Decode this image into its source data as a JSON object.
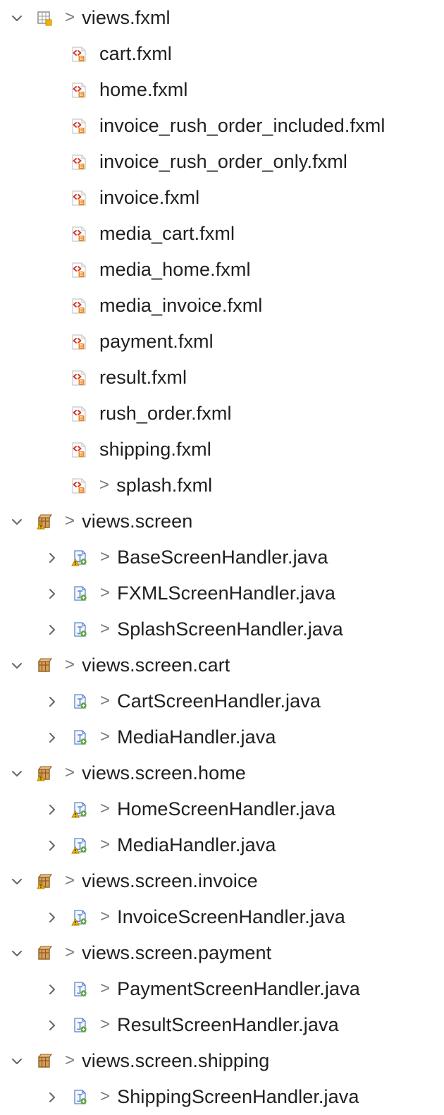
{
  "tree": [
    {
      "kind": "package",
      "variant": "package-empty",
      "expanded": true,
      "decorator": ">",
      "label": "views.fxml",
      "children": [
        {
          "kind": "file",
          "variant": "fxml",
          "label": "cart.fxml"
        },
        {
          "kind": "file",
          "variant": "fxml",
          "label": "home.fxml"
        },
        {
          "kind": "file",
          "variant": "fxml",
          "label": "invoice_rush_order_included.fxml"
        },
        {
          "kind": "file",
          "variant": "fxml",
          "label": "invoice_rush_order_only.fxml"
        },
        {
          "kind": "file",
          "variant": "fxml",
          "label": "invoice.fxml"
        },
        {
          "kind": "file",
          "variant": "fxml",
          "label": "media_cart.fxml"
        },
        {
          "kind": "file",
          "variant": "fxml",
          "label": "media_home.fxml"
        },
        {
          "kind": "file",
          "variant": "fxml",
          "label": "media_invoice.fxml"
        },
        {
          "kind": "file",
          "variant": "fxml",
          "label": "payment.fxml"
        },
        {
          "kind": "file",
          "variant": "fxml",
          "label": "result.fxml"
        },
        {
          "kind": "file",
          "variant": "fxml",
          "label": "rush_order.fxml"
        },
        {
          "kind": "file",
          "variant": "fxml",
          "label": "shipping.fxml"
        },
        {
          "kind": "file",
          "variant": "fxml",
          "label": "splash.fxml",
          "decorator": ">"
        }
      ]
    },
    {
      "kind": "package",
      "variant": "package-warning",
      "expanded": true,
      "decorator": ">",
      "label": "views.screen",
      "children": [
        {
          "kind": "java",
          "variant": "java-warning",
          "decorator": ">",
          "label": "BaseScreenHandler.java"
        },
        {
          "kind": "java",
          "variant": "java",
          "decorator": ">",
          "label": "FXMLScreenHandler.java"
        },
        {
          "kind": "java",
          "variant": "java",
          "decorator": ">",
          "label": "SplashScreenHandler.java"
        }
      ]
    },
    {
      "kind": "package",
      "variant": "package",
      "expanded": true,
      "decorator": ">",
      "label": "views.screen.cart",
      "children": [
        {
          "kind": "java",
          "variant": "java",
          "decorator": ">",
          "label": "CartScreenHandler.java"
        },
        {
          "kind": "java",
          "variant": "java",
          "decorator": ">",
          "label": "MediaHandler.java"
        }
      ]
    },
    {
      "kind": "package",
      "variant": "package-warning",
      "expanded": true,
      "decorator": ">",
      "label": "views.screen.home",
      "children": [
        {
          "kind": "java",
          "variant": "java-warning",
          "decorator": ">",
          "label": "HomeScreenHandler.java"
        },
        {
          "kind": "java",
          "variant": "java-warning",
          "decorator": ">",
          "label": "MediaHandler.java"
        }
      ]
    },
    {
      "kind": "package",
      "variant": "package-warning",
      "expanded": true,
      "decorator": ">",
      "label": "views.screen.invoice",
      "children": [
        {
          "kind": "java",
          "variant": "java-warning",
          "decorator": ">",
          "label": "InvoiceScreenHandler.java"
        }
      ]
    },
    {
      "kind": "package",
      "variant": "package",
      "expanded": true,
      "decorator": ">",
      "label": "views.screen.payment",
      "children": [
        {
          "kind": "java",
          "variant": "java",
          "decorator": ">",
          "label": "PaymentScreenHandler.java"
        },
        {
          "kind": "java",
          "variant": "java",
          "decorator": ">",
          "label": "ResultScreenHandler.java"
        }
      ]
    },
    {
      "kind": "package",
      "variant": "package",
      "expanded": true,
      "decorator": ">",
      "label": "views.screen.shipping",
      "children": [
        {
          "kind": "java",
          "variant": "java",
          "decorator": ">",
          "label": "ShippingScreenHandler.java"
        }
      ]
    }
  ],
  "icons": {
    "expanded": "chevron-down-icon",
    "collapsed": "chevron-right-icon",
    "package-empty": "empty-package-icon",
    "package": "package-icon",
    "package-warning": "package-warning-icon",
    "fxml": "fxml-file-icon",
    "java": "java-file-icon",
    "java-warning": "java-file-warning-icon"
  },
  "colors": {
    "text": "#202020",
    "decorator": "#7a7a7a",
    "twisty": "#666666",
    "package-brown": "#8f5b22",
    "package-tan": "#d6a15b",
    "warning": "#f0b400",
    "fxml-red": "#d33b2f",
    "fxml-orange": "#f08a24",
    "java-blue": "#5a84c8",
    "java-green": "#62a53f"
  }
}
